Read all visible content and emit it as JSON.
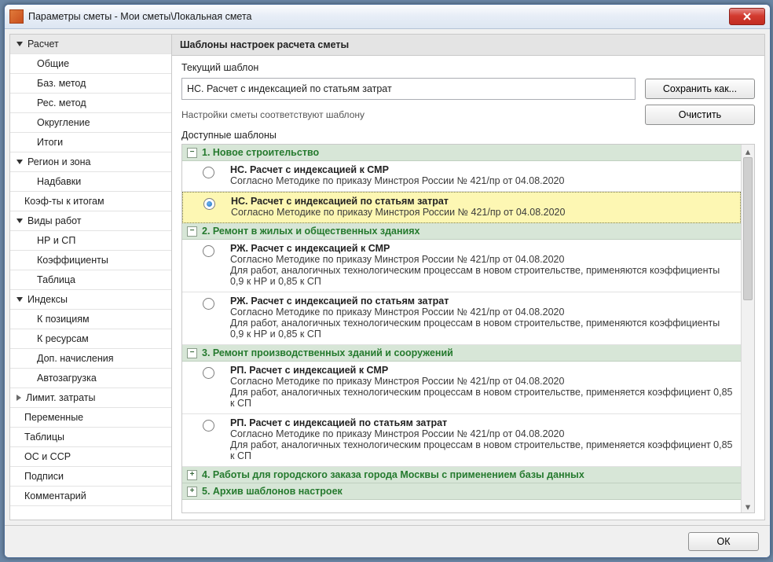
{
  "window": {
    "title": "Параметры сметы - Мои сметы\\Локальная смета"
  },
  "sidebar": {
    "groups": [
      {
        "label": "Расчет",
        "state": "expanded",
        "active": true,
        "items": [
          "Общие",
          "Баз. метод",
          "Рес. метод",
          "Округление",
          "Итоги"
        ]
      },
      {
        "label": "Регион и зона",
        "state": "expanded",
        "items": [
          "Надбавки"
        ]
      },
      {
        "label": "Коэф-ты к итогам",
        "state": "leaf"
      },
      {
        "label": "Виды работ",
        "state": "expanded",
        "items": [
          "НР и СП",
          "Коэффициенты",
          "Таблица"
        ]
      },
      {
        "label": "Индексы",
        "state": "expanded",
        "items": [
          "К позициям",
          "К ресурсам",
          "Доп. начисления",
          "Автозагрузка"
        ]
      },
      {
        "label": "Лимит. затраты",
        "state": "collapsed"
      },
      {
        "label": "Переменные",
        "state": "leaf"
      },
      {
        "label": "Таблицы",
        "state": "leaf"
      },
      {
        "label": "ОС и ССР",
        "state": "leaf"
      },
      {
        "label": "Подписи",
        "state": "leaf"
      },
      {
        "label": "Комментарий",
        "state": "leaf"
      }
    ]
  },
  "main": {
    "section_title": "Шаблоны настроек расчета сметы",
    "current_label": "Текущий шаблон",
    "current_value": "НС. Расчет с индексацией по статьям затрат",
    "hint": "Настройки сметы соответствуют шаблону",
    "save_as": "Сохранить как...",
    "clear": "Очистить",
    "available_label": "Доступные шаблоны"
  },
  "template_groups": [
    {
      "num": "1.",
      "title": "Новое строительство",
      "expanded": true,
      "items": [
        {
          "title": "НС. Расчет с индексацией к СМР",
          "desc": "Согласно Методике по приказу Минстроя России № 421/пр от 04.08.2020",
          "selected": false
        },
        {
          "title": "НС. Расчет с индексацией по статьям затрат",
          "desc": "Согласно Методике по приказу Минстроя России № 421/пр от 04.08.2020",
          "selected": true
        }
      ]
    },
    {
      "num": "2.",
      "title": "Ремонт в жилых и общественных зданиях",
      "expanded": true,
      "items": [
        {
          "title": "РЖ. Расчет с индексацией к СМР",
          "desc": "Согласно Методике по приказу Минстроя России № 421/пр от 04.08.2020\nДля работ, аналогичных технологическим процессам в новом строительстве, применяются коэффициенты 0,9 к НР и 0,85 к СП",
          "selected": false
        },
        {
          "title": "РЖ. Расчет с индексацией по статьям затрат",
          "desc": "Согласно Методике по приказу Минстроя России № 421/пр от 04.08.2020\nДля работ, аналогичных технологическим процессам в новом строительстве, применяются коэффициенты 0,9 к НР и 0,85 к СП",
          "selected": false
        }
      ]
    },
    {
      "num": "3.",
      "title": "Ремонт производственных зданий и сооружений",
      "expanded": true,
      "items": [
        {
          "title": "РП. Расчет с индексацией к СМР",
          "desc": "Согласно Методике по приказу Минстроя России № 421/пр от 04.08.2020\nДля работ, аналогичных технологическим процессам в новом строительстве, применяется коэффициент 0,85 к СП",
          "selected": false
        },
        {
          "title": "РП. Расчет с индексацией по статьям затрат",
          "desc": "Согласно Методике по приказу Минстроя России № 421/пр от 04.08.2020\nДля работ, аналогичных технологическим процессам в новом строительстве, применяется коэффициент 0,85 к СП",
          "selected": false
        }
      ]
    },
    {
      "num": "4.",
      "title": "Работы для городского заказа города Москвы с применением базы данных",
      "expanded": false
    },
    {
      "num": "5.",
      "title": "Архив шаблонов настроек",
      "expanded": false
    }
  ],
  "footer": {
    "ok": "ОК"
  }
}
